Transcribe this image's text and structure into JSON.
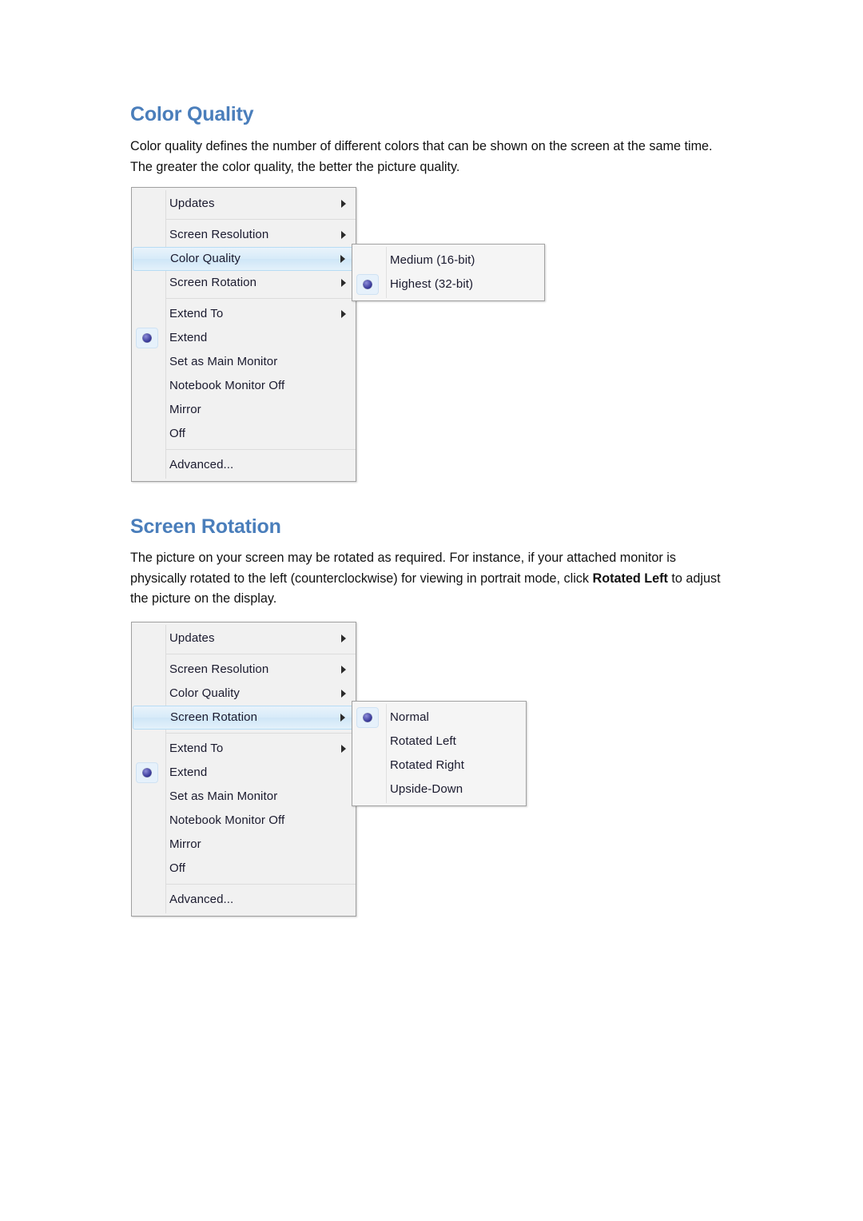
{
  "document": {
    "sections": [
      {
        "heading": "Color Quality",
        "paragraph": "Color quality defines the number of different colors that can be shown on the screen at the same time. The greater the color quality, the better the picture quality."
      },
      {
        "heading": "Screen Rotation",
        "paragraph_part1": "The picture on your screen may be rotated as required. For instance, if your attached monitor is physically rotated to the left (counterclockwise) for viewing in portrait mode, click ",
        "paragraph_bold": "Rotated Left",
        "paragraph_part2": " to adjust the picture on the display."
      }
    ]
  },
  "colors": {
    "heading_blue": "#4a7ebb",
    "menu_background": "#f1f1f1",
    "menu_border": "#a0a0a0",
    "highlight_fill": "#d7ebf9",
    "highlight_border": "#b7dcf4",
    "bullet_blue": "#343493",
    "separator": "#dcdcdc"
  },
  "figure1": {
    "menu": {
      "items": [
        {
          "label": "Updates",
          "has_submenu": true,
          "selected": false,
          "bullet": false
        },
        {
          "label": "Screen Resolution",
          "has_submenu": true,
          "selected": false,
          "bullet": false
        },
        {
          "label": "Color Quality",
          "has_submenu": true,
          "selected": true,
          "bullet": false
        },
        {
          "label": "Screen Rotation",
          "has_submenu": true,
          "selected": false,
          "bullet": false
        },
        {
          "label": "Extend To",
          "has_submenu": true,
          "selected": false,
          "bullet": false
        },
        {
          "label": "Extend",
          "has_submenu": false,
          "selected": false,
          "bullet": true
        },
        {
          "label": "Set as Main Monitor",
          "has_submenu": false,
          "selected": false,
          "bullet": false
        },
        {
          "label": "Notebook Monitor Off",
          "has_submenu": false,
          "selected": false,
          "bullet": false
        },
        {
          "label": "Mirror",
          "has_submenu": false,
          "selected": false,
          "bullet": false
        },
        {
          "label": "Off",
          "has_submenu": false,
          "selected": false,
          "bullet": false
        },
        {
          "label": "Advanced...",
          "has_submenu": false,
          "selected": false,
          "bullet": false
        }
      ]
    },
    "submenu": {
      "items": [
        {
          "label": "Medium (16-bit)",
          "bullet": false
        },
        {
          "label": "Highest (32-bit)",
          "bullet": true
        }
      ]
    }
  },
  "figure2": {
    "menu": {
      "items": [
        {
          "label": "Updates",
          "has_submenu": true,
          "selected": false,
          "bullet": false
        },
        {
          "label": "Screen Resolution",
          "has_submenu": true,
          "selected": false,
          "bullet": false
        },
        {
          "label": "Color Quality",
          "has_submenu": true,
          "selected": false,
          "bullet": false
        },
        {
          "label": "Screen Rotation",
          "has_submenu": true,
          "selected": true,
          "bullet": false
        },
        {
          "label": "Extend To",
          "has_submenu": true,
          "selected": false,
          "bullet": false
        },
        {
          "label": "Extend",
          "has_submenu": false,
          "selected": false,
          "bullet": true
        },
        {
          "label": "Set as Main Monitor",
          "has_submenu": false,
          "selected": false,
          "bullet": false
        },
        {
          "label": "Notebook Monitor Off",
          "has_submenu": false,
          "selected": false,
          "bullet": false
        },
        {
          "label": "Mirror",
          "has_submenu": false,
          "selected": false,
          "bullet": false
        },
        {
          "label": "Off",
          "has_submenu": false,
          "selected": false,
          "bullet": false
        },
        {
          "label": "Advanced...",
          "has_submenu": false,
          "selected": false,
          "bullet": false
        }
      ]
    },
    "submenu": {
      "items": [
        {
          "label": "Normal",
          "bullet": true
        },
        {
          "label": "Rotated Left",
          "bullet": false
        },
        {
          "label": "Rotated Right",
          "bullet": false
        },
        {
          "label": "Upside-Down",
          "bullet": false
        }
      ]
    }
  }
}
